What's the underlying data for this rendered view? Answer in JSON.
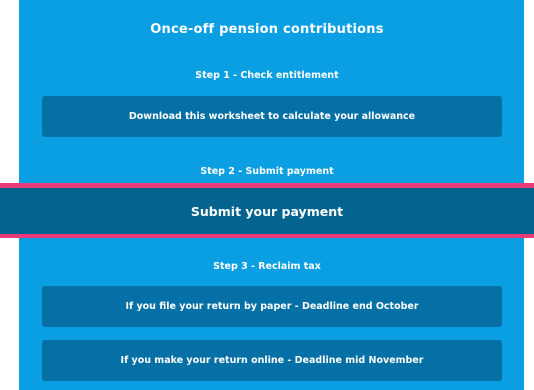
{
  "page": {
    "title": "Once-off pension contributions"
  },
  "steps": [
    {
      "heading": "Step 1 - Check entitlement",
      "buttons": [
        "Download this worksheet to calculate your allowance"
      ]
    },
    {
      "heading": "Step 2 - Submit payment",
      "buttons": [
        "Submit your payment"
      ]
    },
    {
      "heading": "Step 3 - Reclaim tax",
      "buttons": [
        "If you file your return by paper - Deadline end October",
        "If you make your return online - Deadline mid November"
      ]
    }
  ],
  "colors": {
    "panel_bg": "#0a9fe3",
    "button_bg": "#0570a6",
    "highlight_border": "#e8397a",
    "submit_bg": "#05638f"
  }
}
